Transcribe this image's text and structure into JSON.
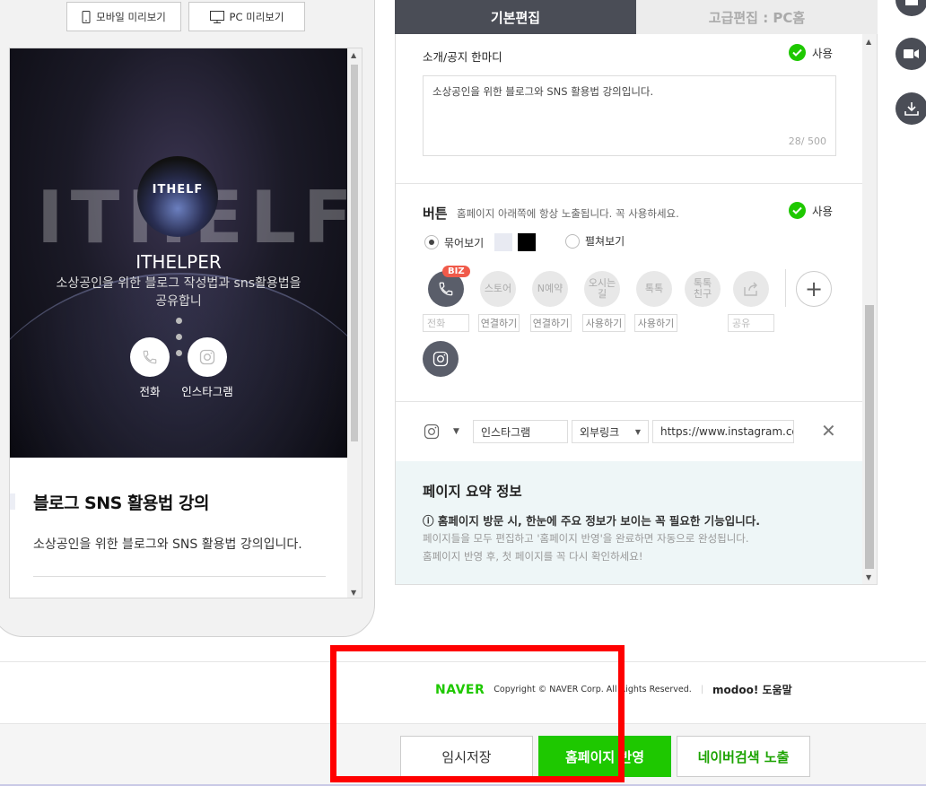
{
  "preview": {
    "mobile_label": "모바일 미리보기",
    "pc_label": "PC 미리보기",
    "hero_bg_text": "ITHELF",
    "logo_text": "ITHELF",
    "brand_name": "ITHELPER",
    "brand_desc": "소상공인을 위한 블로그 작성법과 sns활용법을 공유합니",
    "actions": [
      {
        "label": "전화",
        "icon": "phone-icon"
      },
      {
        "label": "인스타그램",
        "icon": "instagram-icon"
      }
    ],
    "post_title": "블로그 SNS 활용법 강의",
    "post_desc": "소상공인을 위한 블로그와 SNS 활용법 강의입니다."
  },
  "tabs": {
    "basic": "기본편집",
    "advanced": "고급편집 : PC홈"
  },
  "intro": {
    "label": "소개/공지 한마디",
    "use_label": "사용",
    "text": "소상공인을 위한 블로그와 SNS 활용법 강의입니다.",
    "counter": "28/ 500"
  },
  "buttons": {
    "title": "버튼",
    "subtitle": "홈페이지 아래쪽에 항상 노출됩니다. 꼭 사용하세요.",
    "use_label": "사용",
    "radio_group": "묶어보기",
    "radio_spread": "펼쳐보기",
    "biz_badge": "BIZ",
    "services": [
      {
        "circle": "",
        "label": "전화"
      },
      {
        "circle": "스토어",
        "label": "연결하기"
      },
      {
        "circle": "N예약",
        "label": "연결하기"
      },
      {
        "circle": "오시는길",
        "label": "사용하기"
      },
      {
        "circle": "톡톡",
        "label": "사용하기"
      },
      {
        "circle": "톡톡친구",
        "label": ""
      },
      {
        "circle": "",
        "label": "공유"
      }
    ]
  },
  "link_row": {
    "name": "인스타그램",
    "type": "외부링크",
    "url": "https://www.instagram.com/i"
  },
  "summary": {
    "title": "페이지 요약 정보",
    "line1": "ⓘ 홈페이지 방문 시, 한눈에 주요 정보가 보이는 꼭 필요한 기능입니다.",
    "line2": "페이지들을 모두 편집하고 '홈페이지 반영'을 완료하면 자동으로 완성됩니다.",
    "line3": "홈페이지 반영 후, 첫 페이지를 꼭 다시 확인하세요!"
  },
  "footer": {
    "logo": "NAVER",
    "copyright": "Copyright © NAVER Corp. All Rights Reserved.",
    "help": "modoo! 도움말"
  },
  "actions": {
    "save": "임시저장",
    "publish": "홈페이지 반영",
    "expose": "네이버검색 노출"
  },
  "colors": {
    "accent_green": "#1ec800",
    "tab_dark": "#4a4d56",
    "highlight": "#ff0000"
  }
}
